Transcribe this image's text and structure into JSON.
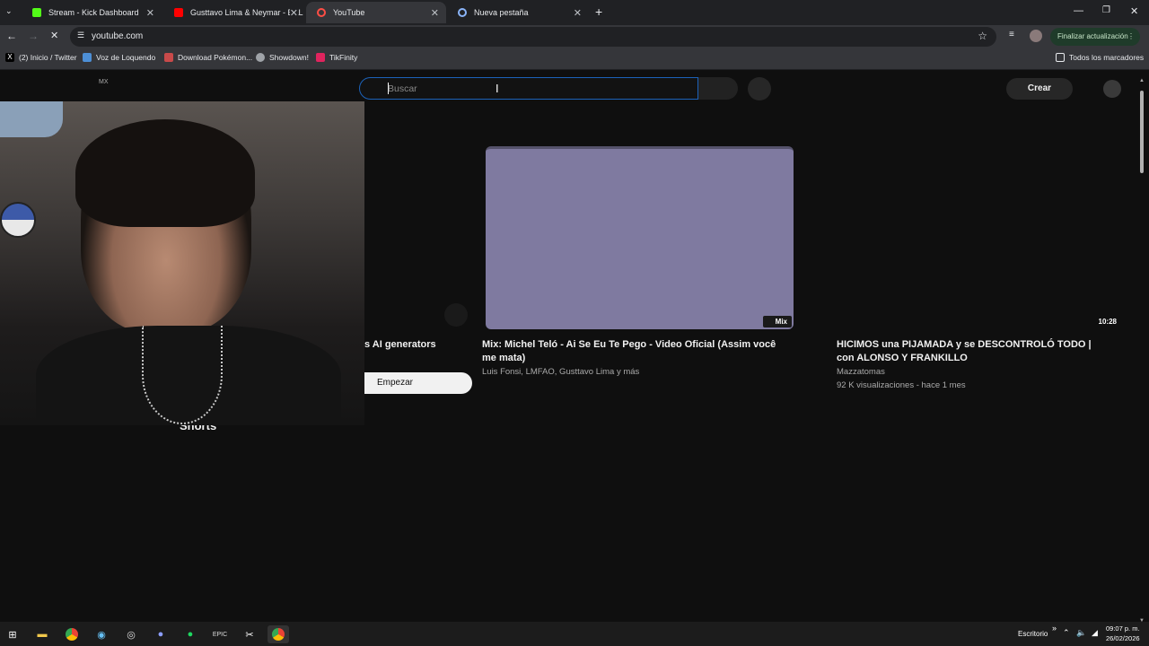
{
  "browser": {
    "tabs": [
      {
        "title": "Stream - Kick Dashboard",
        "favicon_color": "#53fc18"
      },
      {
        "title": "Gusttavo Lima & Neymar - BAL",
        "favicon_color": "#ff0000"
      },
      {
        "title": "YouTube",
        "favicon_color": "#ff4e45"
      },
      {
        "title": "Nueva pestaña",
        "favicon_color": "#8ab4f8"
      }
    ],
    "url": "youtube.com",
    "update_button": "Finalizar actualización",
    "bookmarks": [
      {
        "label": "(2) Inicio / Twitter"
      },
      {
        "label": "Voz de Loquendo"
      },
      {
        "label": "Download Pokémon..."
      },
      {
        "label": "Showdown!"
      },
      {
        "label": "TikFinity"
      }
    ],
    "all_bookmarks": "Todos los marcadores"
  },
  "youtube": {
    "region": "MX",
    "search_placeholder": "Buscar",
    "create_label": "Crear",
    "left_partial_title": "s AI generators",
    "start_button": "Empezar",
    "shorts_label": "Shorts",
    "videos": [
      {
        "title": "Mix: Michel Teló - Ai Se Eu Te Pego -  Video Oficial (Assim você me mata)",
        "channel": "Luis Fonsi, LMFAO, Gusttavo Lima y más",
        "badge": "Mix",
        "thumb_color": "#7f7aa0"
      },
      {
        "title": "HICIMOS una PIJAMADA y se DESCONTROLÓ TODO | con ALONSO Y FRANKILLO",
        "channel": "Mazzatomas",
        "meta": "92 K visualizaciones - hace 1 mes",
        "badge": "10:28"
      }
    ]
  },
  "taskbar": {
    "desktop_label": "Escritorio",
    "time": "09:07 p. m.",
    "date": "26/02/2026"
  },
  "colors": {
    "accent_blue": "#1c62b9",
    "page_bg": "#0f0f0f"
  }
}
